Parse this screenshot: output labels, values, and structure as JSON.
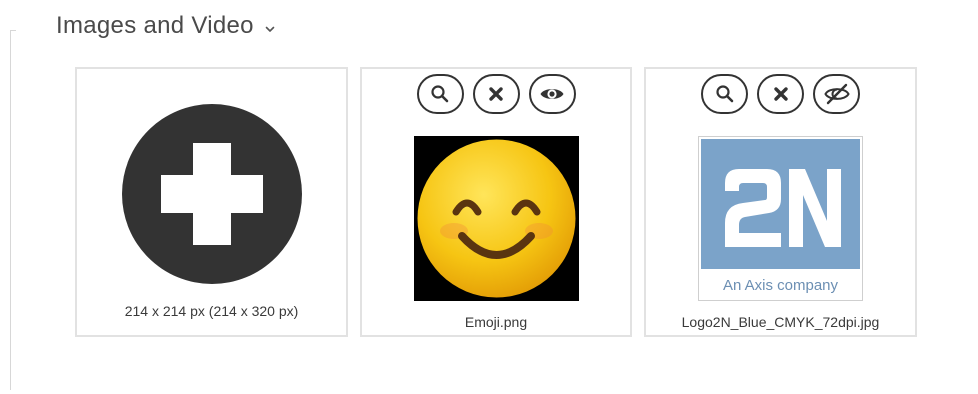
{
  "section": {
    "title": "Images and Video",
    "chevron_icon": "chevron-down-icon"
  },
  "cards": {
    "add": {
      "icon": "plus-icon",
      "caption": "214 x 214 px (214 x 320 px)"
    },
    "emoji": {
      "filename": "Emoji.png",
      "tools": [
        "zoom-icon",
        "close-icon",
        "eye-icon"
      ]
    },
    "logo": {
      "filename": "Logo2N_Blue_CMYK_72dpi.jpg",
      "tools": [
        "zoom-icon",
        "close-icon",
        "eye-off-icon"
      ],
      "logo_mark": "2N",
      "logo_tagline": "An Axis company"
    }
  },
  "colors": {
    "dark": "#333333",
    "border": "#e2e2e2",
    "logo_blue": "#7ba3c9",
    "emoji_yellow": "#f6c513"
  }
}
